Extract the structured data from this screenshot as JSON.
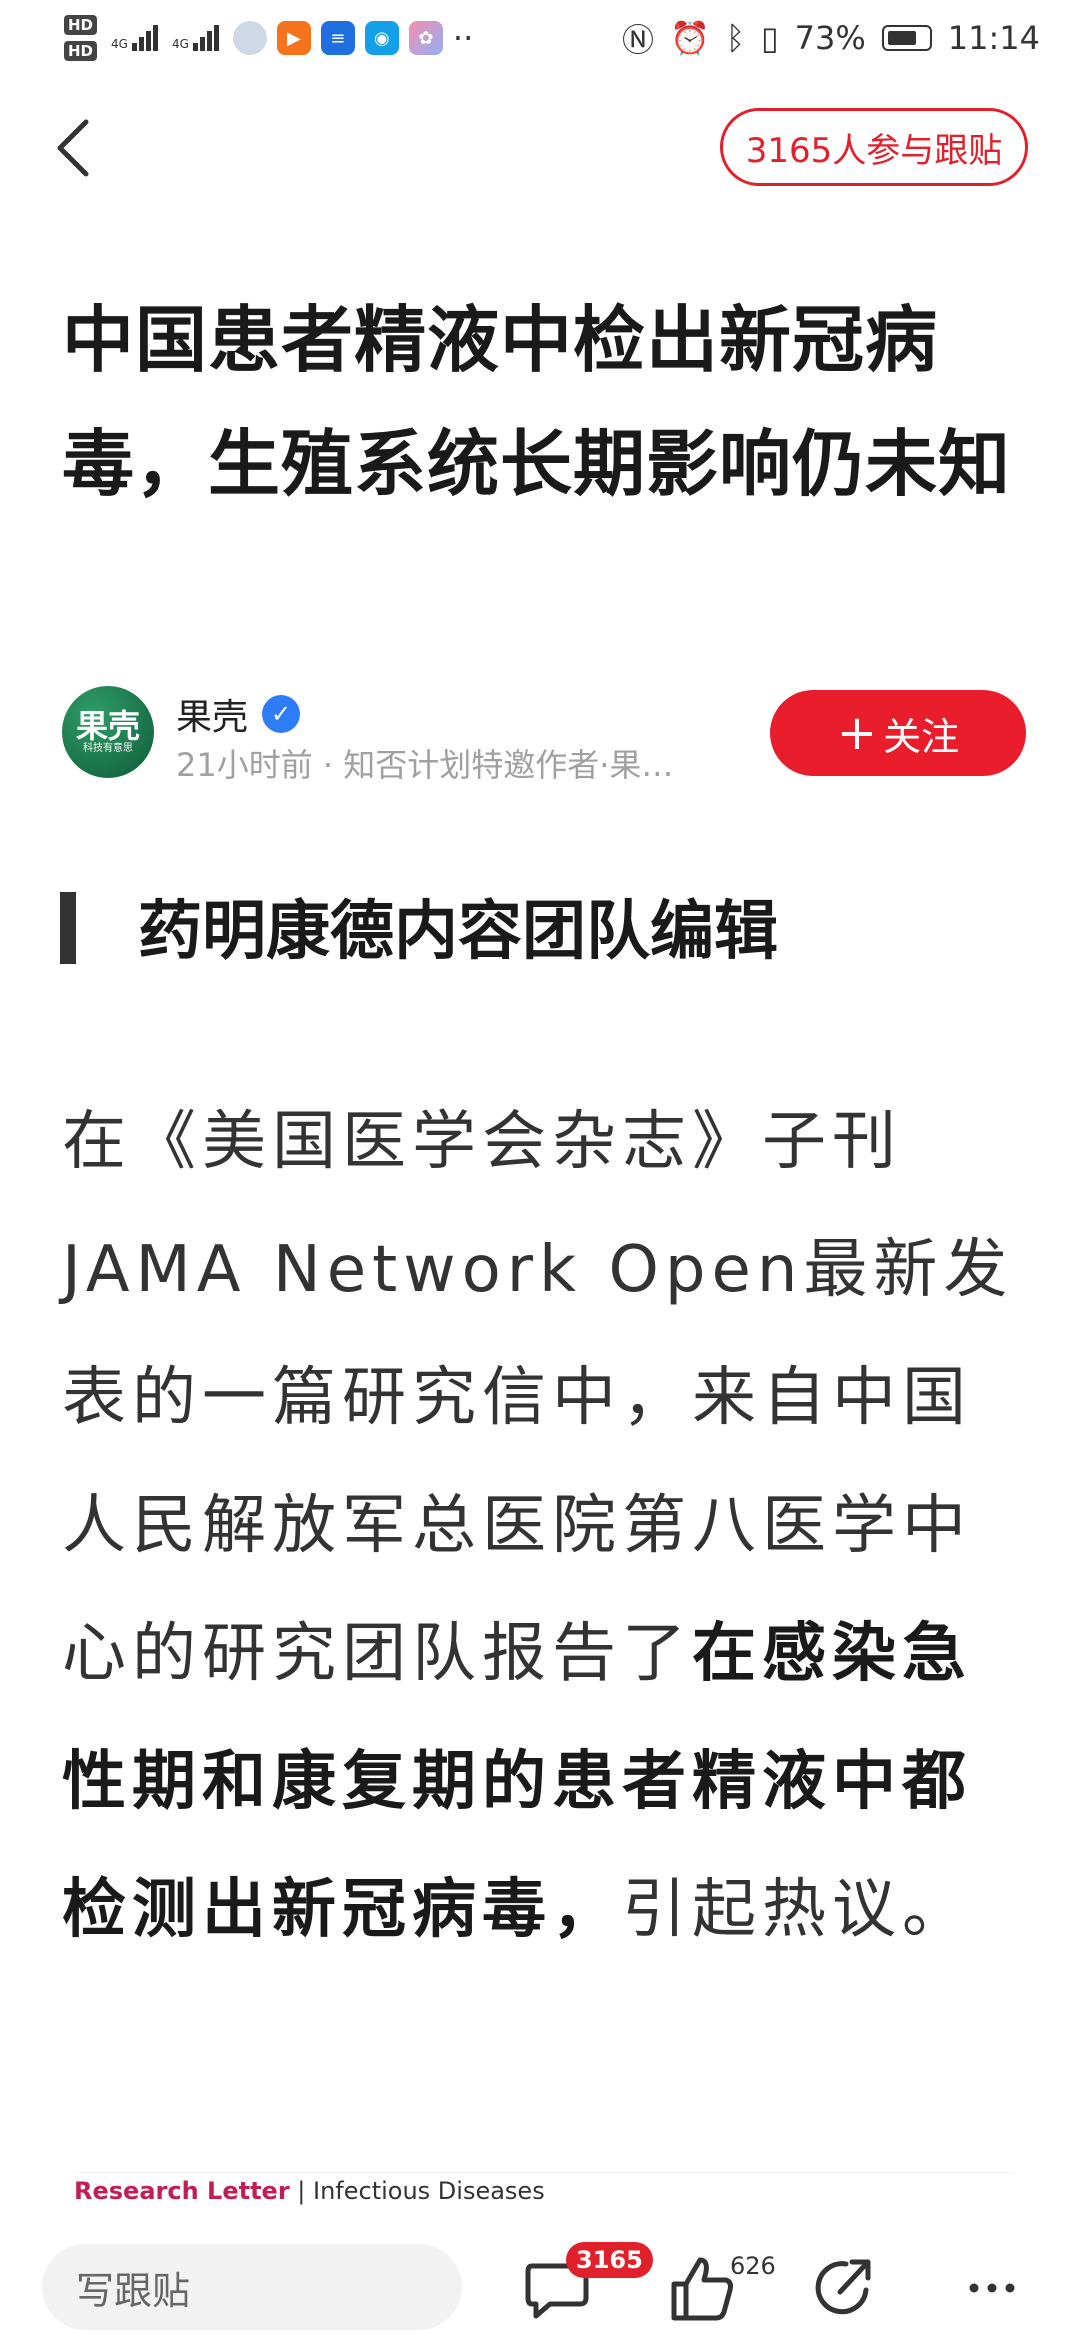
{
  "status_bar": {
    "hd_top": "HD",
    "hd_bottom": "HD",
    "network_1": "4G",
    "network_2": "4G",
    "dots": "··",
    "battery_percent": "73%",
    "time": "11:14",
    "icons": [
      "nfc-icon",
      "alarm-icon",
      "bluetooth-icon",
      "vibrate-icon",
      "battery-icon"
    ]
  },
  "header": {
    "follow_post_count": "3165人参与跟贴"
  },
  "article": {
    "title": "中国患者精液中检出新冠病毒，生殖系统长期影响仍未知",
    "author": {
      "avatar_text": "果壳",
      "avatar_subtext": "科技有意思",
      "name": "果壳",
      "meta": "21小时前 · 知否计划特邀作者·果…",
      "follow_label": "关注"
    },
    "heading": "药明康德内容团队编辑",
    "body_normal": "在《美国医学会杂志》子刊JAMA Network Open最新发表的一篇研究信中，来自中国人民解放军总医院第八医学中心的研究团队报告了",
    "body_bold": "在感染急性期和康复期的患者精液中都检测出新冠病毒，",
    "body_end": "引起热议。",
    "research_label": "Research Letter",
    "research_separator": " | ",
    "research_category": "Infectious Diseases"
  },
  "bottom_bar": {
    "input_placeholder": "写跟贴",
    "comment_count": "3165",
    "like_count": "626"
  },
  "colors": {
    "accent_red": "#e0202b",
    "verified_blue": "#2f7df6",
    "avatar_green": "#0e5a3a"
  }
}
